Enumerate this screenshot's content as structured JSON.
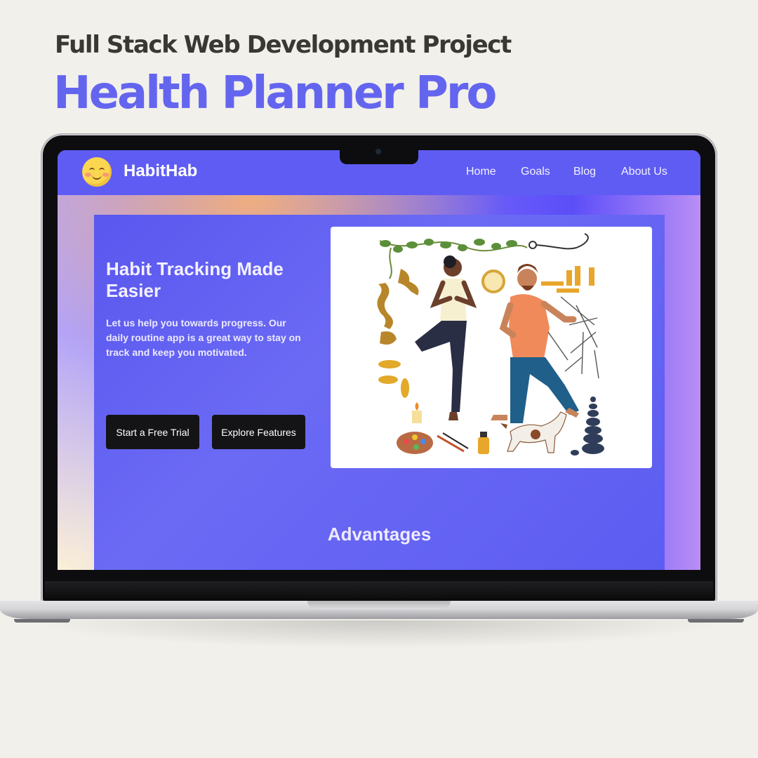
{
  "promo": {
    "kicker": "Full Stack Web Development Project",
    "headline": "Health Planner Pro"
  },
  "app": {
    "brand": "HabitHab",
    "nav": [
      "Home",
      "Goals",
      "Blog",
      "About Us"
    ],
    "hero": {
      "title": "Habit Tracking Made Easier",
      "text": "Let us help you towards progress. Our daily routine app is a great way to stay on track and keep you motivated.",
      "primary_button": "Start a Free Trial",
      "secondary_button": "Explore Features"
    },
    "section_heading": "Advantages"
  },
  "colors": {
    "accent": "#6465ef",
    "nav_bg": "#5f5cf4",
    "button_bg": "#141416"
  },
  "icons": [
    "smiley-logo-icon",
    "yoga-illustration"
  ]
}
